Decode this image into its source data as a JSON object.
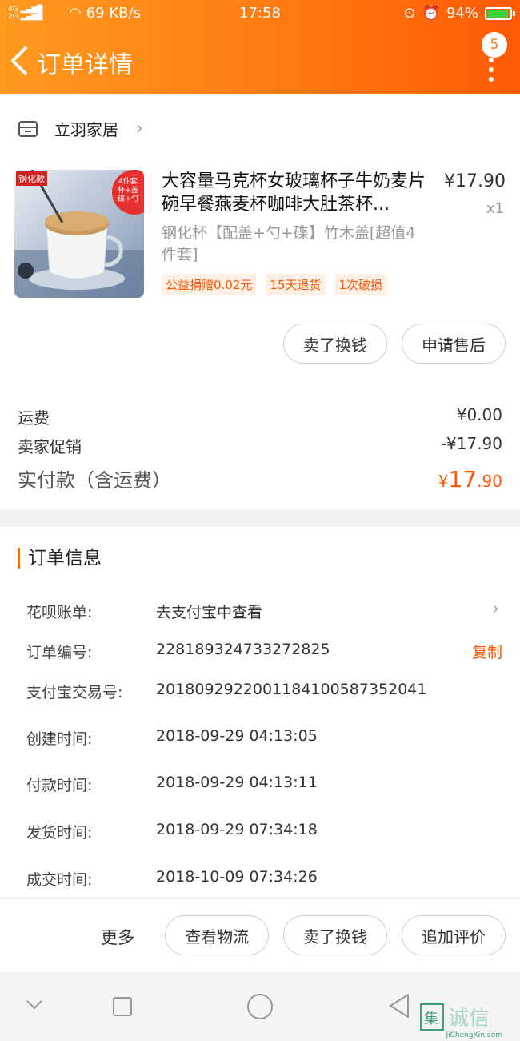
{
  "status_bar": {
    "net_speed": "69 KB/s",
    "time": "17:58",
    "battery": "94%"
  },
  "nav": {
    "title": "订单详情",
    "badge_count": "5"
  },
  "shop": {
    "name": "立羽家居"
  },
  "product": {
    "thumb_label": "钢化款",
    "thumb_badge": "4件套",
    "thumb_badge_sub": "杯+盖 碟+勺",
    "title": "大容量马克杯女玻璃杯子牛奶麦片碗早餐燕麦杯咖啡大肚茶杯...",
    "price": "¥17.90",
    "quantity": "x1",
    "sku": "钢化杯【配盖+勺+碟】竹木盖[超值4件套]",
    "tags": [
      "公益捐赠0.02元",
      "15天退货",
      "1次破损"
    ]
  },
  "item_actions": {
    "sell_label": "卖了换钱",
    "after_sale_label": "申请售后"
  },
  "fees": {
    "shipping_label": "运费",
    "shipping_value": "¥0.00",
    "promo_label": "卖家促销",
    "promo_value": "-¥17.90",
    "paid_label": "实付款（含运费）",
    "paid_currency": "¥",
    "paid_int": "17",
    "paid_dec": ".90"
  },
  "order_info": {
    "title": "订单信息",
    "huabei_label": "花呗账单:",
    "huabei_value": "去支付宝中查看",
    "order_no_label": "订单编号:",
    "order_no": "2281893247332728​25",
    "copy_label": "复制",
    "alipay_no_label": "支付宝交易号:",
    "alipay_no": "2018092922001184100587352041",
    "created_label": "创建时间:",
    "created": "2018-09-29 04:13:05",
    "paid_label": "付款时间:",
    "paid": "2018-09-29 04:13:11",
    "shipped_label": "发货时间:",
    "shipped": "2018-09-29 07:34:18",
    "done_label": "成交时间:",
    "done": "2018-10-09 07:34:26"
  },
  "bottom_actions": {
    "more_label": "更多",
    "logistics_label": "查看物流",
    "sell_label": "卖了换钱",
    "review_label": "追加评价"
  },
  "watermark": {
    "text": "JiChengXin.com"
  },
  "colors": {
    "accent": "#ff5500",
    "header_start": "#ff9a1f",
    "header_end": "#ff5a05"
  }
}
